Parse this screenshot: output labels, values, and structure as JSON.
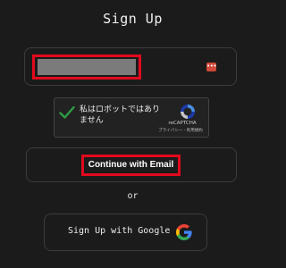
{
  "header": {
    "title": "Sign Up"
  },
  "email": {
    "value": "",
    "password_manager_icon": "dots-icon",
    "password_manager_glyph": "•••"
  },
  "captcha": {
    "checked": true,
    "label": "私はロボットではありません",
    "brand": "reCAPTCHA",
    "links": "プライバシー - 利用規約"
  },
  "actions": {
    "continue_email_label": "Continue with Email",
    "separator": "or",
    "google_label": "Sign Up with Google"
  },
  "colors": {
    "background": "#1b1b1b",
    "highlight": "#e2091d",
    "check": "#2e9a46",
    "google_blue": "#4285F4",
    "google_red": "#EA4335",
    "google_yellow": "#FBBC05",
    "google_green": "#34A853"
  }
}
